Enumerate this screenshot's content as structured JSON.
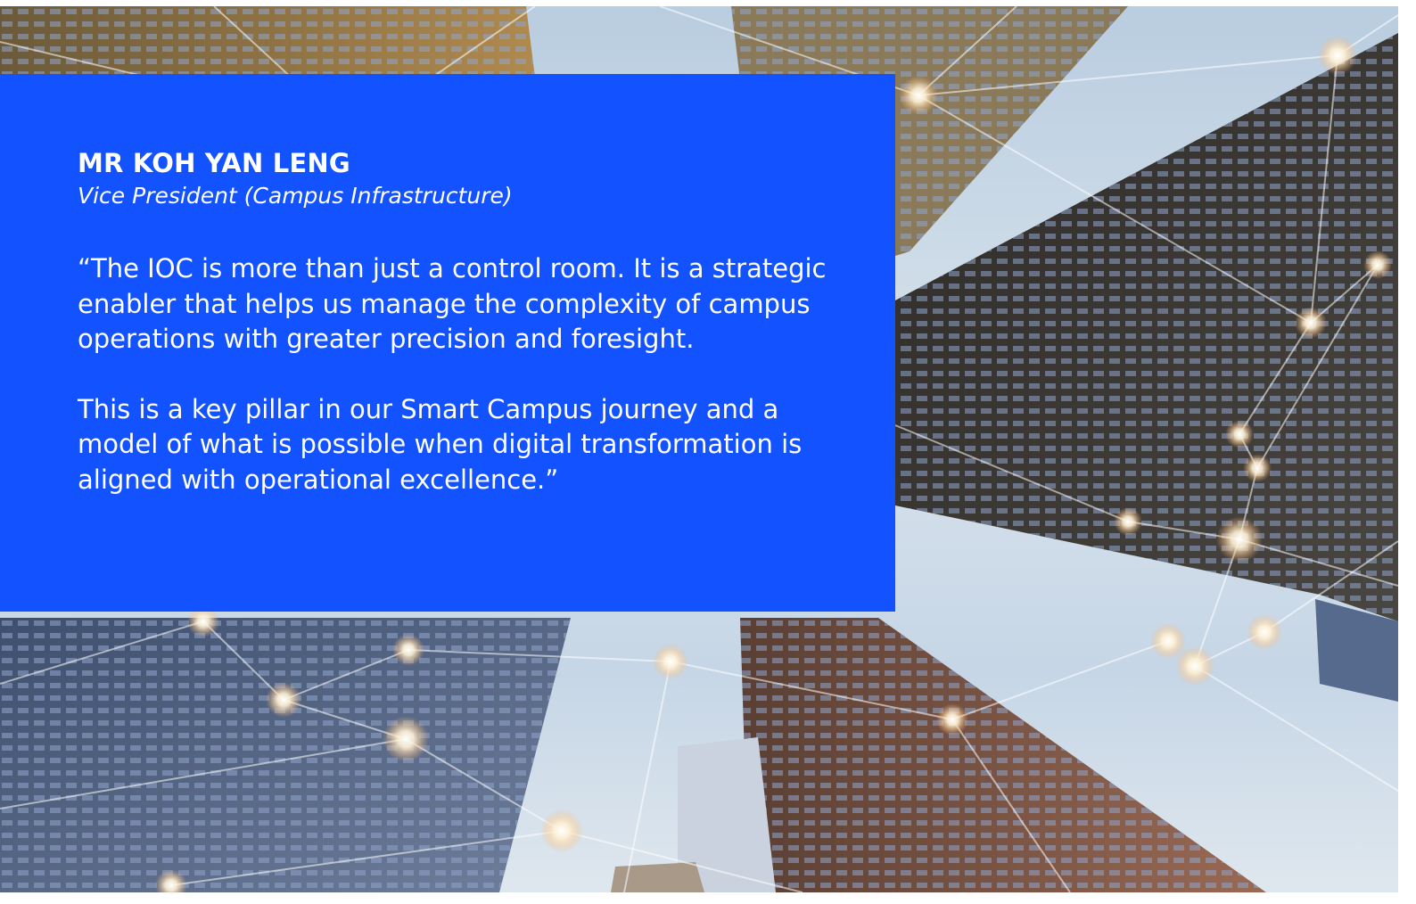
{
  "speaker": {
    "name": "MR KOH YAN LENG",
    "role": "Vice President (Campus Infrastructure)"
  },
  "quote": {
    "paragraphs": [
      "“The IOC is more than just a control room. It is a strategic enabler that helps us manage the complexity of campus operations with greater precision and foresight.",
      "This is a key pillar in our Smart Campus journey and a model of what is possible when digital transformation is aligned with operational excellence.”"
    ]
  },
  "colors": {
    "card_background": "#1352ff",
    "text": "#ffffff"
  },
  "background_image": {
    "subject": "skyscrapers-looking-up-network-lines-icon"
  }
}
